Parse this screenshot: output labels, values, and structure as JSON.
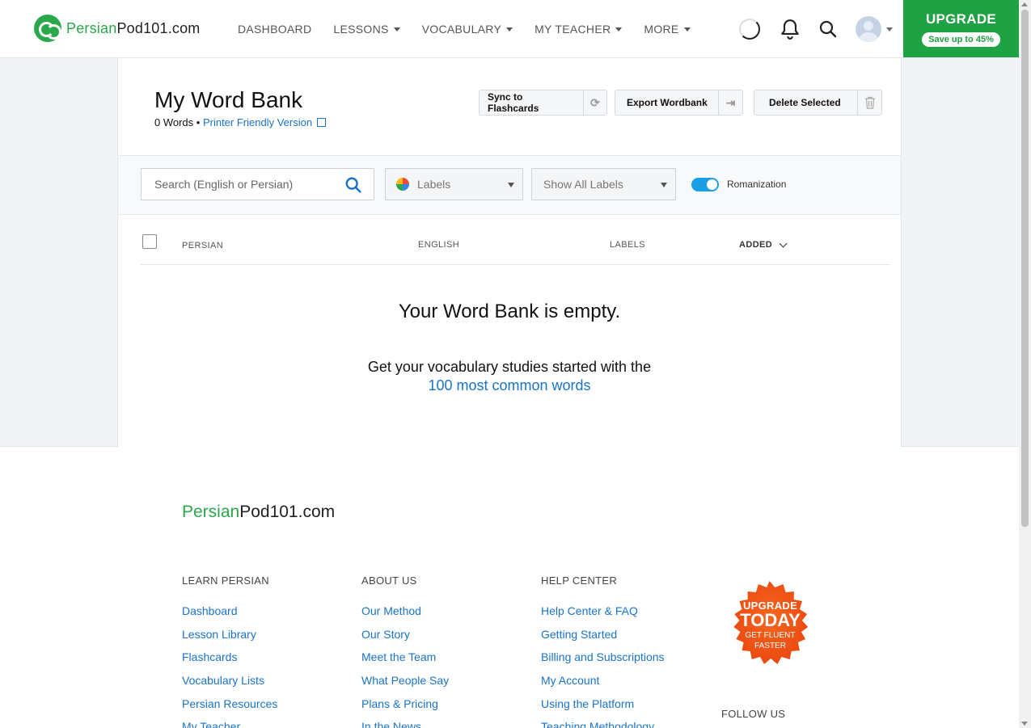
{
  "header": {
    "logo_green": "Persian",
    "logo_dark": "Pod101.com",
    "nav": [
      {
        "label": "DASHBOARD",
        "dropdown": false
      },
      {
        "label": "LESSONS",
        "dropdown": true
      },
      {
        "label": "VOCABULARY",
        "dropdown": true
      },
      {
        "label": "MY TEACHER",
        "dropdown": true
      },
      {
        "label": "MORE",
        "dropdown": true
      }
    ],
    "upgrade_title": "UPGRADE",
    "upgrade_sub": "Save up to 45%"
  },
  "wordbank": {
    "title": "My Word Bank",
    "count": "0 Words",
    "separator": " • ",
    "printer_link": "Printer Friendly Version",
    "buttons": {
      "sync": "Sync to Flashcards",
      "export": "Export Wordbank",
      "delete": "Delete Selected"
    },
    "search_placeholder": "Search (English or Persian)",
    "labels_select": "Labels",
    "show_labels_select": "Show All Labels",
    "romanization_label": "Romanization",
    "romanization_on": true,
    "columns": {
      "persian": "PERSIAN",
      "english": "ENGLISH",
      "labels": "LABELS",
      "added": "ADDED"
    },
    "empty_heading": "Your Word Bank is empty.",
    "empty_text": "Get your vocabulary studies started with the",
    "empty_link": "100 most common words"
  },
  "footer": {
    "logo_green": "Persian",
    "logo_dark": "Pod101.com",
    "columns": [
      {
        "heading": "LEARN PERSIAN",
        "links": [
          "Dashboard",
          "Lesson Library",
          "Flashcards",
          "Vocabulary Lists",
          "Persian Resources",
          "My Teacher"
        ]
      },
      {
        "heading": "ABOUT US",
        "links": [
          "Our Method",
          "Our Story",
          "Meet the Team",
          "What People Say",
          "Plans & Pricing",
          "In the News"
        ]
      },
      {
        "heading": "HELP CENTER",
        "links": [
          "Help Center & FAQ",
          "Getting Started",
          "Billing and Subscriptions",
          "My Account",
          "Using the Platform",
          "Teaching Methodology"
        ]
      }
    ],
    "badge": {
      "line1": "UPGRADE",
      "line2": "TODAY",
      "line3": "GET FLUENT",
      "line4": "FASTER"
    },
    "follow_us": "FOLLOW US"
  },
  "colors": {
    "brand_green": "#1fa243",
    "link_blue": "#1a73c7",
    "toggle_blue": "#1a9fe6",
    "badge_orange": "#f05a1a"
  }
}
